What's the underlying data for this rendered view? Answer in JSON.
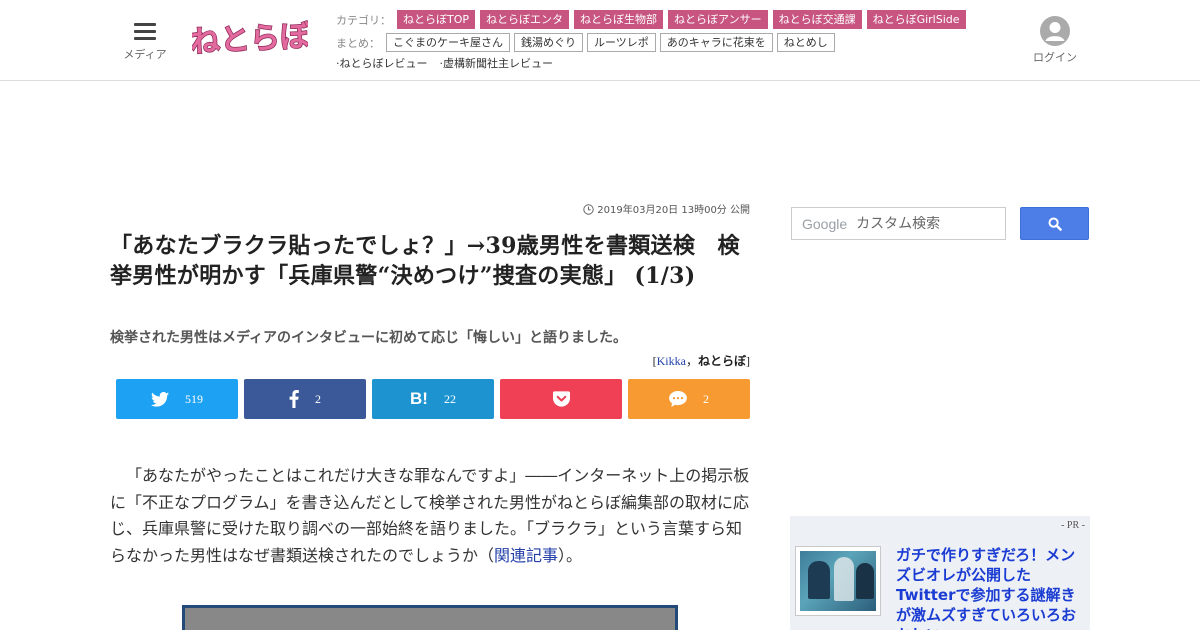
{
  "header": {
    "menu_label": "メディア",
    "login_label": "ログイン",
    "logo_text": "ねとらぼ",
    "category_label": "カテゴリ：",
    "categories": [
      "ねとらぼTOP",
      "ねとらぼエンタ",
      "ねとらぼ生物部",
      "ねとらぼアンサー",
      "ねとらぼ交通課",
      "ねとらぼGirlSide"
    ],
    "summary_label": "まとめ：",
    "summaries": [
      "こぐまのケーキ屋さん",
      "銭湯めぐり",
      "ルーツレポ",
      "あのキャラに花束を",
      "ねとめし"
    ],
    "reviews": [
      "·ねとらぼレビュー",
      "·虚構新聞社主レビュー"
    ]
  },
  "article": {
    "published": "2019年03月20日 13時00分 公開",
    "title": "「あなたブラクラ貼ったでしょ？」→39歳男性を書類送検　検挙男性が明かす「兵庫県警“決めつけ”捜査の実態」 (1/3)",
    "subtitle": "検挙された男性はメディアのインタビューに初めて応じ「悔しい」と語りました。",
    "byline_open": "[",
    "author": "Kikka",
    "byline_sep": "，",
    "site": "ねとらぼ",
    "byline_close": "]",
    "body_before_link": "「あなたがやったことはこれだけ大きな罪なんですよ」――インターネット上の掲示板に「不正なプログラム」を書き込んだとして検挙された男性がねとらぼ編集部の取材に応じ、兵庫県警に受けた取り調べの一部始終を語りました。「ブラクラ」という言葉すら知らなかった男性はなぜ書類送検されたのでしょうか（",
    "body_link": "関連記事",
    "body_after_link": "）。"
  },
  "share": {
    "twitter_count": "519",
    "facebook_count": "2",
    "hatena_label": "B!",
    "hatena_count": "22",
    "comment_count": "2",
    "colors": {
      "twitter": "#1da1f2",
      "facebook": "#3b5998",
      "hatena": "#1d93d0",
      "pocket": "#ef4056",
      "comment": "#f79a32"
    }
  },
  "sidebar": {
    "search_brand": "Google",
    "search_placeholder": "カスタム検索",
    "pr_label": "- PR -",
    "pr_title": "ガチで作りすぎだろ！メンズビオレが公開したTwitterで参加する謎解きが激ムズすぎていろいろおかしい"
  },
  "theme": {
    "category_color": "#c7557f",
    "link_color": "#2340a8",
    "search_button_color": "#4d7ee8"
  },
  "icons": {
    "menu": "hamburger-icon",
    "login": "user-avatar-icon",
    "clock": "clock-icon",
    "search": "search-icon"
  }
}
